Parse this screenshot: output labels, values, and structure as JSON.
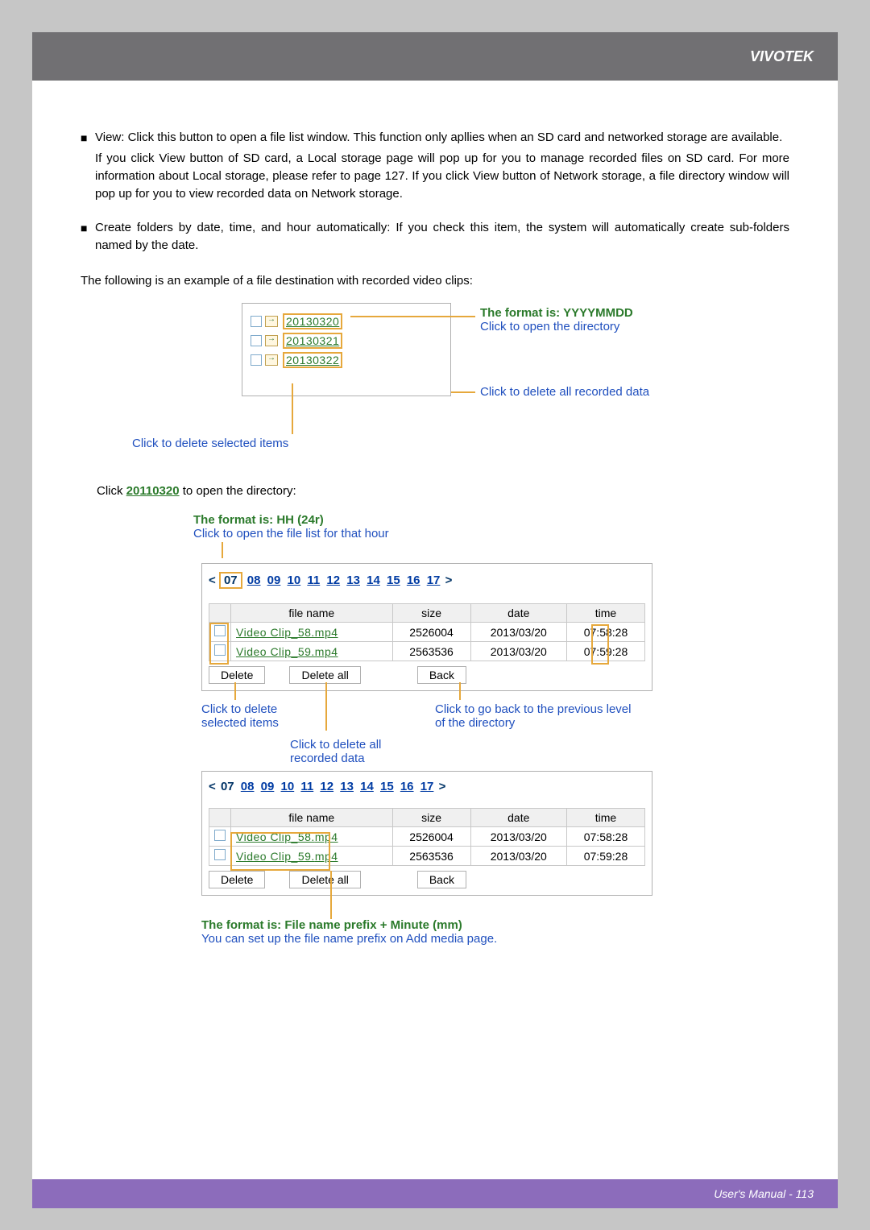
{
  "header": {
    "brand": "VIVOTEK"
  },
  "bullet1": {
    "lead": "View: Click this button to open a file list window. This function only apllies when an SD card and networked storage are available.",
    "sub": "If you click View button of SD card, a Local storage page will pop up for you to manage recorded files on SD card. For more information about Local storage, please refer to page 127. If you click View button of Network storage, a file directory window will pop up for you to view recorded data on Network storage."
  },
  "bullet2": "Create folders by date, time, and hour automatically: If you check this item, the system will automatically create sub-folders named by the date.",
  "example_intro": "The following is an example of a file destination with recorded video clips:",
  "folders": [
    "20130320",
    "20130321",
    "20130322"
  ],
  "call1a": "The format is: YYYYMMDD",
  "call1b": "Click to open the directory",
  "call2": "Click to delete all recorded data",
  "call3": "Click to delete selected items",
  "open_dir_pre": "Click ",
  "open_dir_link": "20110320",
  "open_dir_post": " to open the directory:",
  "call4a": "The format is: HH (24r)",
  "call4b": "Click to open the file list for that hour",
  "hours": {
    "nav_left": "<",
    "nav_right": ">",
    "current": "07",
    "list": [
      "08",
      "09",
      "10",
      "11",
      "12",
      "13",
      "14",
      "15",
      "16",
      "17"
    ]
  },
  "table": {
    "headers": {
      "fname": "file name",
      "size": "size",
      "date": "date",
      "time": "time"
    },
    "rows": [
      {
        "fname": "Video Clip_58.mp4",
        "size": "2526004",
        "date": "2013/03/20",
        "time": "07:58:28",
        "time_h": "07",
        "time_m": "58",
        "time_s": "28",
        "fname_pre": "Video Clip_58.",
        "fname_ext": "mp4"
      },
      {
        "fname": "Video Clip_59.mp4",
        "size": "2563536",
        "date": "2013/03/20",
        "time": "07:59:28",
        "time_h": "07",
        "time_m": "59",
        "time_s": "28",
        "fname_pre": "Video Clip_59.",
        "fname_ext": "mp4"
      }
    ]
  },
  "buttons": {
    "delete": "Delete",
    "delete_all": "Delete all",
    "back": "Back"
  },
  "call5": "Click to delete selected items",
  "call6": "Click to delete all recorded data",
  "call7": "Click to go back to the previous level of the directory",
  "call8a": "The format is: File name prefix + Minute (mm)",
  "call8b": "You can set up the file name prefix on Add media page.",
  "footer": "User's Manual - 113"
}
